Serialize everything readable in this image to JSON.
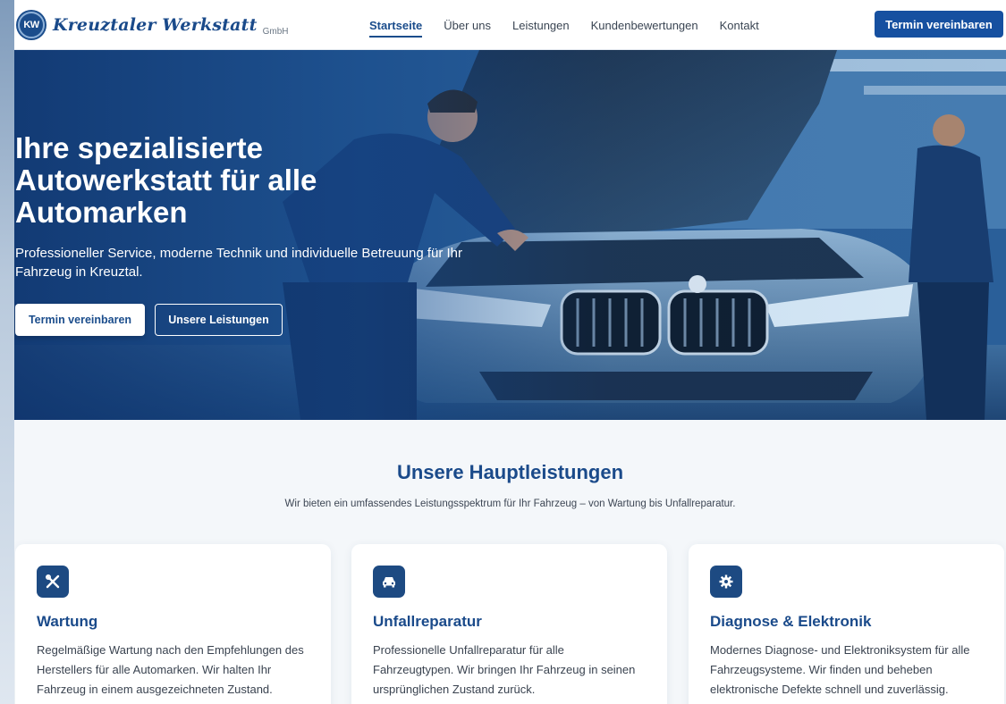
{
  "brand": {
    "logo_text": "KW",
    "name": "Kreuztaler Werkstatt",
    "suffix": "GmbH"
  },
  "nav": {
    "items": [
      {
        "label": "Startseite",
        "active": true
      },
      {
        "label": "Über uns",
        "active": false
      },
      {
        "label": "Leistungen",
        "active": false
      },
      {
        "label": "Kundenbewertungen",
        "active": false
      },
      {
        "label": "Kontakt",
        "active": false
      }
    ],
    "cta_label": "Termin vereinbaren"
  },
  "hero": {
    "title": "Ihre spezialisierte Autowerkstatt für alle Automarken",
    "subtitle": "Professioneller Service, moderne Technik und individuelle Betreuung für Ihr Fahrzeug in Kreuztal.",
    "primary_button": "Termin vereinbaren",
    "secondary_button": "Unsere Leistungen"
  },
  "services": {
    "title": "Unsere Hauptleistungen",
    "subtitle": "Wir bieten ein umfassendes Leistungsspektrum für Ihr Fahrzeug – von Wartung bis Unfallreparatur.",
    "cards": [
      {
        "icon": "wrench-screwdriver-icon",
        "title": "Wartung",
        "text": "Regelmäßige Wartung nach den Empfehlungen des Herstellers für alle Automarken. Wir halten Ihr Fahrzeug in einem ausgezeichneten Zustand."
      },
      {
        "icon": "car-icon",
        "title": "Unfallreparatur",
        "text": "Professionelle Unfallreparatur für alle Fahrzeugtypen. Wir bringen Ihr Fahrzeug in seinen ursprünglichen Zustand zurück."
      },
      {
        "icon": "gear-icon",
        "title": "Diagnose & Elektronik",
        "text": "Modernes Diagnose- und Elektroniksystem für alle Fahrzeugsysteme. Wir finden und beheben elektronische Defekte schnell und zuverlässig."
      }
    ]
  },
  "colors": {
    "primary": "#1b4d8c",
    "cta": "#1650a0",
    "background": "#f4f7fa"
  }
}
